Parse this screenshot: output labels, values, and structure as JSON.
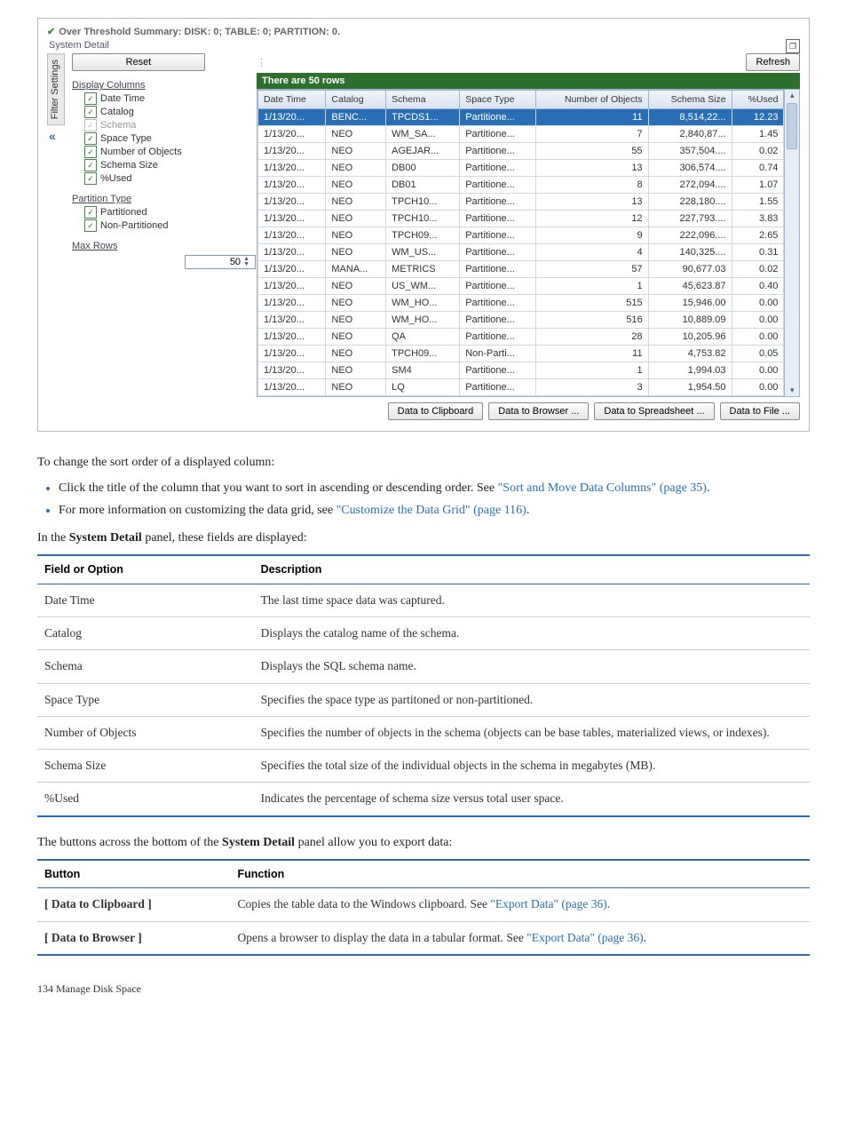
{
  "panel": {
    "title": "Over Threshold Summary: DISK: 0; TABLE: 0; PARTITION: 0.",
    "systemDetail": "System Detail",
    "reset": "Reset",
    "refresh": "Refresh",
    "filterTab": "Filter Settings",
    "statusBar": "There are 50 rows",
    "sections": {
      "displayColumns": "Display Columns",
      "partitionType": "Partition Type",
      "maxRows": "Max Rows"
    },
    "checks": {
      "dateTime": "Date Time",
      "catalog": "Catalog",
      "schema": "Schema",
      "spaceType": "Space Type",
      "numObjects": "Number of Objects",
      "schemaSize": "Schema Size",
      "pctUsed": "%Used",
      "partitioned": "Partitioned",
      "nonPartitioned": "Non-Partitioned"
    },
    "maxRowsValue": "50",
    "headers": {
      "dateTime": "Date Time",
      "catalog": "Catalog",
      "schema": "Schema",
      "spaceType": "Space Type",
      "numObjects": "Number of Objects",
      "schemaSize": "Schema Size",
      "pctUsed": "%Used"
    },
    "rows": [
      {
        "dt": "1/13/20...",
        "cat": "BENC...",
        "sch": "TPCDS1...",
        "st": "Partitione...",
        "no": "11",
        "ss": "8,514,22...",
        "pu": "12.23"
      },
      {
        "dt": "1/13/20...",
        "cat": "NEO",
        "sch": "WM_SA...",
        "st": "Partitione...",
        "no": "7",
        "ss": "2,840,87...",
        "pu": "1.45"
      },
      {
        "dt": "1/13/20...",
        "cat": "NEO",
        "sch": "AGEJAR...",
        "st": "Partitione...",
        "no": "55",
        "ss": "357,504....",
        "pu": "0.02"
      },
      {
        "dt": "1/13/20...",
        "cat": "NEO",
        "sch": "DB00",
        "st": "Partitione...",
        "no": "13",
        "ss": "306,574....",
        "pu": "0.74"
      },
      {
        "dt": "1/13/20...",
        "cat": "NEO",
        "sch": "DB01",
        "st": "Partitione...",
        "no": "8",
        "ss": "272,094....",
        "pu": "1.07"
      },
      {
        "dt": "1/13/20...",
        "cat": "NEO",
        "sch": "TPCH10...",
        "st": "Partitione...",
        "no": "13",
        "ss": "228,180....",
        "pu": "1.55"
      },
      {
        "dt": "1/13/20...",
        "cat": "NEO",
        "sch": "TPCH10...",
        "st": "Partitione...",
        "no": "12",
        "ss": "227,793....",
        "pu": "3.83"
      },
      {
        "dt": "1/13/20...",
        "cat": "NEO",
        "sch": "TPCH09...",
        "st": "Partitione...",
        "no": "9",
        "ss": "222,096....",
        "pu": "2.65"
      },
      {
        "dt": "1/13/20...",
        "cat": "NEO",
        "sch": "WM_US...",
        "st": "Partitione...",
        "no": "4",
        "ss": "140,325....",
        "pu": "0.31"
      },
      {
        "dt": "1/13/20...",
        "cat": "MANA...",
        "sch": "METRICS",
        "st": "Partitione...",
        "no": "57",
        "ss": "90,677.03",
        "pu": "0.02"
      },
      {
        "dt": "1/13/20...",
        "cat": "NEO",
        "sch": "US_WM...",
        "st": "Partitione...",
        "no": "1",
        "ss": "45,623.87",
        "pu": "0.40"
      },
      {
        "dt": "1/13/20...",
        "cat": "NEO",
        "sch": "WM_HO...",
        "st": "Partitione...",
        "no": "515",
        "ss": "15,946.00",
        "pu": "0.00"
      },
      {
        "dt": "1/13/20...",
        "cat": "NEO",
        "sch": "WM_HO...",
        "st": "Partitione...",
        "no": "516",
        "ss": "10,889.09",
        "pu": "0.00"
      },
      {
        "dt": "1/13/20...",
        "cat": "NEO",
        "sch": "QA",
        "st": "Partitione...",
        "no": "28",
        "ss": "10,205.96",
        "pu": "0.00"
      },
      {
        "dt": "1/13/20...",
        "cat": "NEO",
        "sch": "TPCH09...",
        "st": "Non-Parti...",
        "no": "11",
        "ss": "4,753.82",
        "pu": "0.05"
      },
      {
        "dt": "1/13/20...",
        "cat": "NEO",
        "sch": "SM4",
        "st": "Partitione...",
        "no": "1",
        "ss": "1,994.03",
        "pu": "0.00"
      },
      {
        "dt": "1/13/20...",
        "cat": "NEO",
        "sch": "LQ",
        "st": "Partitione...",
        "no": "3",
        "ss": "1,954.50",
        "pu": "0.00"
      }
    ],
    "buttons": {
      "clip": "Data to Clipboard",
      "browser": "Data to Browser ...",
      "spread": "Data to Spreadsheet ...",
      "file": "Data to File ..."
    }
  },
  "doc": {
    "para1": "To change the sort order of a displayed column:",
    "bullet1a": "Click the title of the column that you want to sort in ascending or descending order. See ",
    "bullet1link": "\"Sort and Move Data Columns\" (page 35)",
    "bullet1b": ".",
    "bullet2a": "For more information on customizing the data grid, see ",
    "bullet2link": "\"Customize the Data Grid\" (page 116)",
    "bullet2b": ".",
    "para2a": "In the ",
    "para2bold": "System Detail",
    "para2b": " panel, these fields are displayed:",
    "table1": {
      "h1": "Field or Option",
      "h2": "Description",
      "rows": [
        [
          "Date Time",
          "The last time space data was captured."
        ],
        [
          "Catalog",
          "Displays the catalog name of the schema."
        ],
        [
          "Schema",
          "Displays the SQL schema name."
        ],
        [
          "Space Type",
          "Specifies the space type as partitoned or non-partitioned."
        ],
        [
          "Number of Objects",
          "Specifies the number of objects in the schema (objects can be base tables, materialized views, or indexes)."
        ],
        [
          "Schema Size",
          "Specifies the total size of the individual objects in the schema in megabytes (MB)."
        ],
        [
          "%Used",
          "Indicates the percentage of schema size versus total user space."
        ]
      ]
    },
    "para3a": "The buttons across the bottom of the ",
    "para3bold": "System Detail",
    "para3b": " panel allow you to export data:",
    "table2": {
      "h1": "Button",
      "h2": "Function",
      "rows": [
        {
          "b": "[ Data to Clipboard ]",
          "t1": "Copies the table data to the Windows clipboard. See ",
          "link": "\"Export Data\" (page 36)",
          "t2": "."
        },
        {
          "b": "[ Data to Browser ]",
          "t1": "Opens a browser to display the data in a tabular format. See ",
          "link": "\"Export Data\" (page 36)",
          "t2": "."
        }
      ]
    },
    "footer": "134    Manage Disk Space"
  }
}
